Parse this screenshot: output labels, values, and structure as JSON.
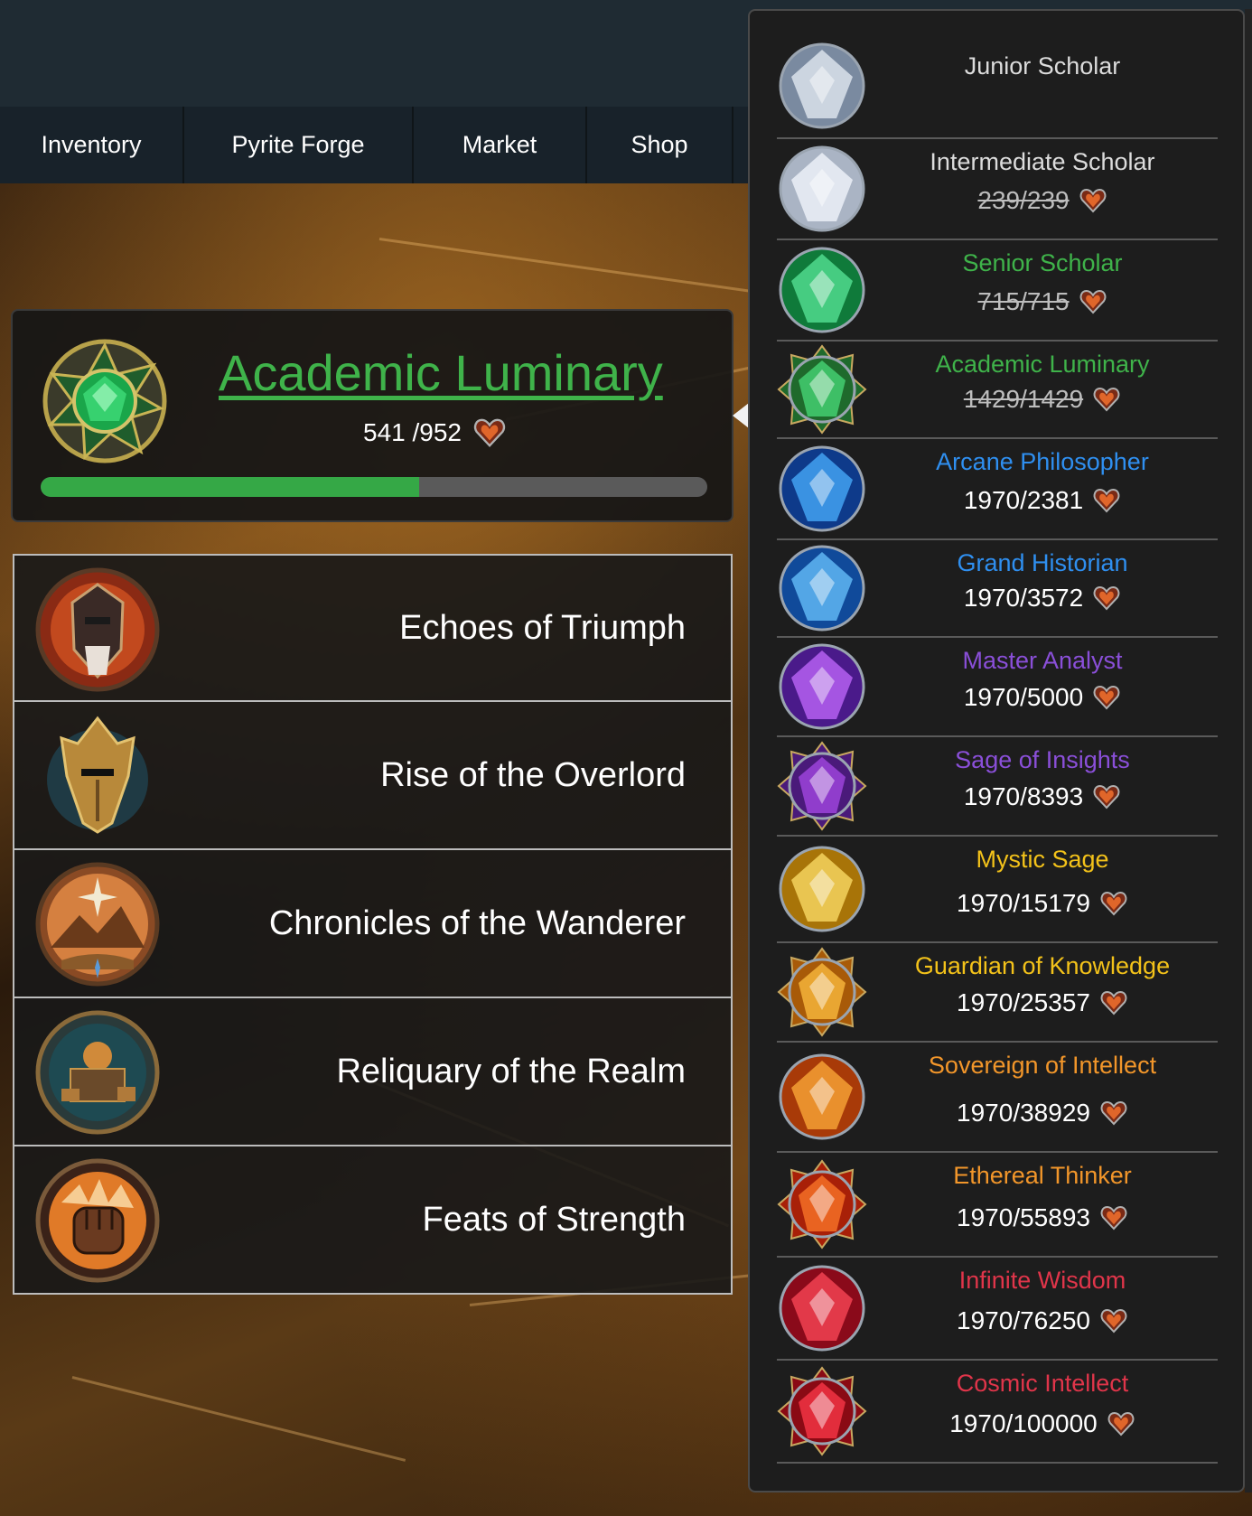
{
  "nav": {
    "items": [
      "Inventory",
      "Pyrite Forge",
      "Market",
      "Shop"
    ]
  },
  "rank": {
    "title": "Academic Luminary",
    "progress_text": "541 /952",
    "progress": 0.568,
    "color": "#3fb34a"
  },
  "collections": [
    {
      "label": "Echoes of Triumph",
      "icon": "helmet-shield-icon"
    },
    {
      "label": "Rise of the Overlord",
      "icon": "overlord-helmet-icon"
    },
    {
      "label": "Chronicles of the Wanderer",
      "icon": "compass-landscape-icon"
    },
    {
      "label": "Reliquary of the Realm",
      "icon": "reliquary-icon"
    },
    {
      "label": "Feats of Strength",
      "icon": "fist-icon"
    }
  ],
  "tiers": [
    {
      "name": "Junior Scholar",
      "progress": "",
      "color": "#dcdcdc",
      "completed": true,
      "gem": "silver-crystal-icon"
    },
    {
      "name": "Intermediate Scholar",
      "progress": "239/239",
      "color": "#dcdcdc",
      "completed": true,
      "gem": "diamond-icon"
    },
    {
      "name": "Senior Scholar",
      "progress": "715/715",
      "color": "#3fb34a",
      "completed": true,
      "gem": "emerald-icon"
    },
    {
      "name": "Academic Luminary",
      "progress": "1429/1429",
      "color": "#3fb34a",
      "completed": true,
      "gem": "ornate-emerald-icon"
    },
    {
      "name": "Arcane Philosopher",
      "progress": "1970/2381",
      "color": "#2f8ff0",
      "completed": false,
      "gem": "sapphire-icon"
    },
    {
      "name": "Grand Historian",
      "progress": "1970/3572",
      "color": "#2f8ff0",
      "completed": false,
      "gem": "blue-crystal-icon"
    },
    {
      "name": "Master Analyst",
      "progress": "1970/5000",
      "color": "#8a4fd8",
      "completed": false,
      "gem": "amethyst-icon"
    },
    {
      "name": "Sage of Insights",
      "progress": "1970/8393",
      "color": "#8a4fd8",
      "completed": false,
      "gem": "ornate-amethyst-icon"
    },
    {
      "name": "Mystic Sage",
      "progress": "1970/15179",
      "color": "#f3c21a",
      "completed": false,
      "gem": "topaz-icon"
    },
    {
      "name": "Guardian of Knowledge",
      "progress": "1970/25357",
      "color": "#f3c21a",
      "completed": false,
      "gem": "ornate-topaz-icon"
    },
    {
      "name": "Sovereign of Intellect",
      "progress": "1970/38929",
      "color": "#f2962a",
      "completed": false,
      "gem": "fire-opal-icon"
    },
    {
      "name": "Ethereal Thinker",
      "progress": "1970/55893",
      "color": "#f2962a",
      "completed": false,
      "gem": "ornate-fire-opal-icon"
    },
    {
      "name": "Infinite Wisdom",
      "progress": "1970/76250",
      "color": "#e0354a",
      "completed": false,
      "gem": "ruby-icon"
    },
    {
      "name": "Cosmic Intellect",
      "progress": "1970/100000",
      "color": "#e0354a",
      "completed": false,
      "gem": "ornate-ruby-icon"
    }
  ]
}
